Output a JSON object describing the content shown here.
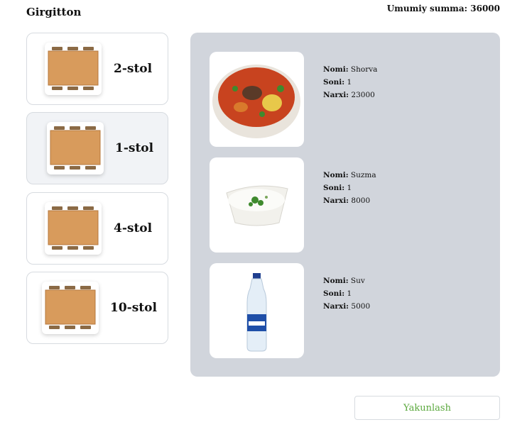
{
  "app": {
    "title": "Girgitton"
  },
  "header": {
    "total_label": "Umumiy summa:",
    "total_value": "36000"
  },
  "tables": [
    {
      "label": "2-stol",
      "active": false
    },
    {
      "label": "1-stol",
      "active": true
    },
    {
      "label": "4-stol",
      "active": false
    },
    {
      "label": "10-stol",
      "active": false
    }
  ],
  "order": {
    "labels": {
      "name": "Nomi:",
      "qty": "Soni:",
      "price": "Narxi:"
    },
    "items": [
      {
        "name": "Shorva",
        "qty": "1",
        "price": "23000",
        "image": "soup-bowl"
      },
      {
        "name": "Suzma",
        "qty": "1",
        "price": "8000",
        "image": "yogurt-bowl"
      },
      {
        "name": "Suv",
        "qty": "1",
        "price": "5000",
        "image": "water-bottle"
      }
    ]
  },
  "footer": {
    "finish_label": "Yakunlash",
    "finish_color": "#5aa83d"
  },
  "colors": {
    "panel_bg": "#d1d5dc",
    "card_border": "#d7dbe0",
    "active_card_bg": "#f1f3f6"
  }
}
